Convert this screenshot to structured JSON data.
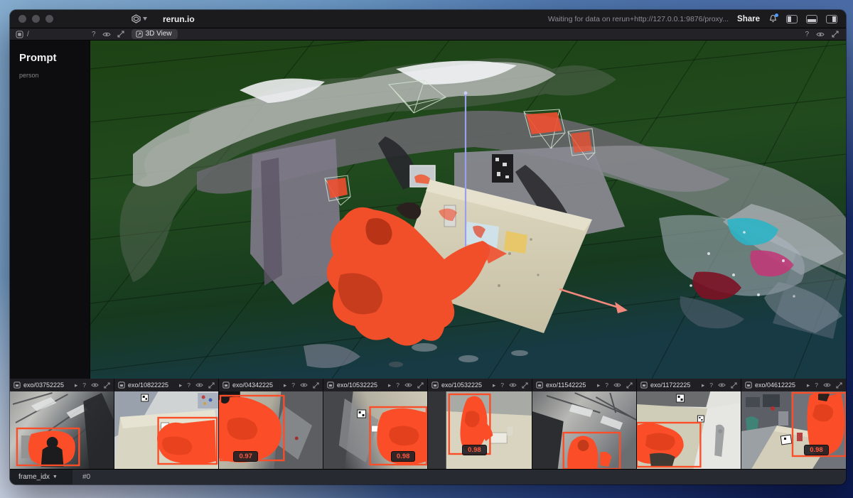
{
  "titlebar": {
    "app_title": "rerun.io",
    "status_text": "Waiting for data on rerun+http://127.0.0.1:9876/proxy...",
    "share_label": "Share"
  },
  "toolbar": {
    "breadcrumb": "/",
    "help_glyph": "?",
    "view_tab_label": "3D View"
  },
  "left_panel": {
    "title": "Prompt",
    "value": "person"
  },
  "thumbnails": {
    "play_glyph": "▸",
    "help_glyph": "?",
    "items": [
      {
        "label": "exo/03752225"
      },
      {
        "label": "exo/10822225"
      },
      {
        "label": "exo/04342225",
        "confidence": "0.97"
      },
      {
        "label": "exo/10532225",
        "confidence": "0.98"
      },
      {
        "label": "exo/10532225",
        "confidence": "0.98"
      },
      {
        "label": "exo/11542225"
      },
      {
        "label": "exo/11722225"
      },
      {
        "label": "exo/04612225",
        "confidence": "0.98"
      }
    ]
  },
  "timeline": {
    "field": "frame_idx",
    "caret": "▼",
    "tick": "#0"
  },
  "colors": {
    "mask_orange": "#fb4e28",
    "selection_blue": "#9aa0ee",
    "ground_green": "#1f4517"
  }
}
